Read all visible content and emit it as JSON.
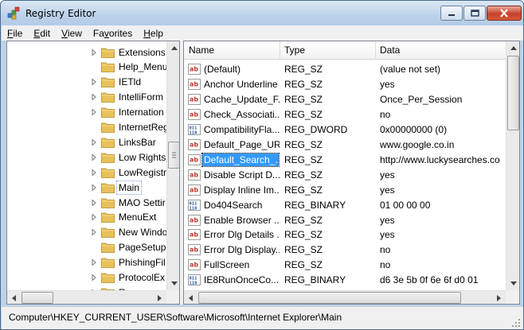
{
  "window": {
    "title": "Registry Editor"
  },
  "menu": [
    {
      "label": "File",
      "mnemonic": "F",
      "rest": "ile"
    },
    {
      "label": "Edit",
      "mnemonic": "E",
      "rest": "dit"
    },
    {
      "label": "View",
      "mnemonic": "V",
      "rest": "iew"
    },
    {
      "label": "Favorites",
      "mnemonic": "",
      "rest": "Fa",
      "mnemonic_mid": "v",
      "rest_end": "orites"
    },
    {
      "label": "Help",
      "mnemonic": "H",
      "rest": "elp"
    }
  ],
  "tree": {
    "items": [
      {
        "label": "Extensions",
        "expandable": true,
        "selected": false
      },
      {
        "label": "Help_Menu",
        "expandable": false,
        "selected": false
      },
      {
        "label": "IETld",
        "expandable": true,
        "selected": false
      },
      {
        "label": "IntelliForm",
        "expandable": true,
        "selected": false
      },
      {
        "label": "Internation",
        "expandable": true,
        "selected": false
      },
      {
        "label": "InternetReg",
        "expandable": false,
        "selected": false
      },
      {
        "label": "LinksBar",
        "expandable": true,
        "selected": false
      },
      {
        "label": "Low Rights",
        "expandable": true,
        "selected": false
      },
      {
        "label": "LowRegistr",
        "expandable": true,
        "selected": false
      },
      {
        "label": "Main",
        "expandable": true,
        "selected": true
      },
      {
        "label": "MAO Settir",
        "expandable": true,
        "selected": false
      },
      {
        "label": "MenuExt",
        "expandable": true,
        "selected": false
      },
      {
        "label": "New Windo",
        "expandable": true,
        "selected": false
      },
      {
        "label": "PageSetup",
        "expandable": false,
        "selected": false
      },
      {
        "label": "PhishingFil",
        "expandable": true,
        "selected": false
      },
      {
        "label": "ProtocolEx",
        "expandable": true,
        "selected": false
      },
      {
        "label": "Recovery",
        "expandable": true,
        "selected": false
      }
    ]
  },
  "list": {
    "columns": [
      "Name",
      "Type",
      "Data"
    ],
    "rows": [
      {
        "icon": "string-value-icon",
        "name": "(Default)",
        "type": "REG_SZ",
        "data": "(value not set)",
        "selected": false
      },
      {
        "icon": "string-value-icon",
        "name": "Anchor Underline",
        "type": "REG_SZ",
        "data": "yes",
        "selected": false
      },
      {
        "icon": "string-value-icon",
        "name": "Cache_Update_F...",
        "type": "REG_SZ",
        "data": "Once_Per_Session",
        "selected": false
      },
      {
        "icon": "string-value-icon",
        "name": "Check_Associati...",
        "type": "REG_SZ",
        "data": "no",
        "selected": false
      },
      {
        "icon": "binary-value-icon",
        "name": "CompatibilityFla...",
        "type": "REG_DWORD",
        "data": "0x00000000 (0)",
        "selected": false
      },
      {
        "icon": "string-value-icon",
        "name": "Default_Page_URL",
        "type": "REG_SZ",
        "data": "www.google.co.in",
        "selected": false
      },
      {
        "icon": "string-value-icon",
        "name": "Default_Search_...",
        "type": "REG_SZ",
        "data": "http://www.luckysearches.co",
        "selected": true
      },
      {
        "icon": "string-value-icon",
        "name": "Disable Script D...",
        "type": "REG_SZ",
        "data": "yes",
        "selected": false
      },
      {
        "icon": "string-value-icon",
        "name": "Display Inline Im...",
        "type": "REG_SZ",
        "data": "yes",
        "selected": false
      },
      {
        "icon": "binary-value-icon",
        "name": "Do404Search",
        "type": "REG_BINARY",
        "data": "01 00 00 00",
        "selected": false
      },
      {
        "icon": "string-value-icon",
        "name": "Enable Browser ...",
        "type": "REG_SZ",
        "data": "yes",
        "selected": false
      },
      {
        "icon": "string-value-icon",
        "name": "Error Dlg Details ...",
        "type": "REG_SZ",
        "data": "yes",
        "selected": false
      },
      {
        "icon": "string-value-icon",
        "name": "Error Dlg Display...",
        "type": "REG_SZ",
        "data": "no",
        "selected": false
      },
      {
        "icon": "string-value-icon",
        "name": "FullScreen",
        "type": "REG_SZ",
        "data": "no",
        "selected": false
      },
      {
        "icon": "binary-value-icon",
        "name": "IE8RunOnceCo...",
        "type": "REG_BINARY",
        "data": "d6 3e 5b 0f 6e 6f d0 01",
        "selected": false
      }
    ]
  },
  "status": {
    "path": "Computer\\HKEY_CURRENT_USER\\Software\\Microsoft\\Internet Explorer\\Main"
  },
  "colors": {
    "selection": "#3399ff",
    "folder": "#e8c15a",
    "string_icon": "#c0392b",
    "binary_icon": "#1f4fa0"
  }
}
